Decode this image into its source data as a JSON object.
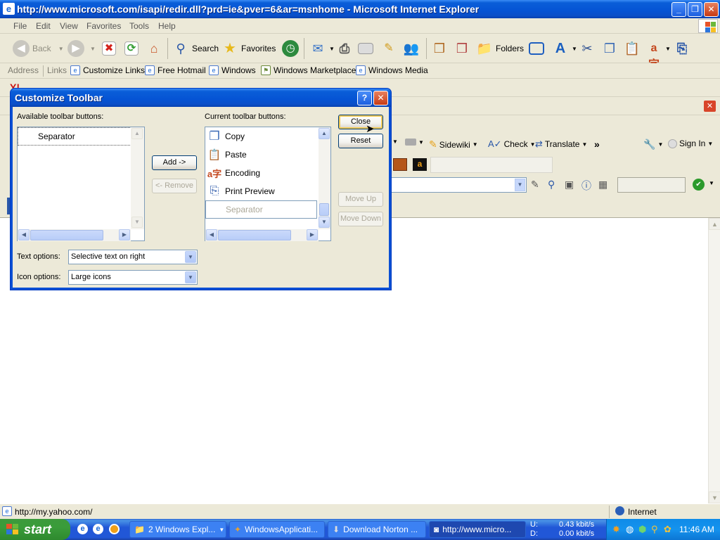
{
  "window": {
    "title": "http://www.microsoft.com/isapi/redir.dll?prd=ie&pver=6&ar=msnhome - Microsoft Internet Explorer",
    "minimize": "_",
    "maximize": "❐",
    "close": "✕"
  },
  "menu": [
    "File",
    "Edit",
    "View",
    "Favorites",
    "Tools",
    "Help"
  ],
  "toolbar": {
    "back": "Back",
    "search": "Search",
    "favorites": "Favorites",
    "folders": "Folders"
  },
  "links_bar": {
    "address": "Address",
    "links": "Links",
    "items": [
      "Customize Links",
      "Free Hotmail",
      "Windows",
      "Windows Marketplace",
      "Windows Media"
    ]
  },
  "yahoo_bar": {
    "sidewiki": "Sidewiki",
    "check": "Check",
    "translate": "Translate",
    "more": "»",
    "sign_in": "Sign In"
  },
  "dialog": {
    "title": "Customize Toolbar",
    "help": "?",
    "close_x": "✕",
    "available_label": "Available toolbar buttons:",
    "available_items": [
      "Separator"
    ],
    "current_label": "Current toolbar buttons:",
    "current_items": [
      "Copy",
      "Paste",
      "Encoding",
      "Print Preview",
      "Separator"
    ],
    "add_button": "Add ->",
    "remove_button": "<- Remove",
    "close_button": "Close",
    "reset_button": "Reset",
    "move_up_button": "Move Up",
    "move_down_button": "Move Down",
    "text_options_label": "Text options:",
    "text_options_value": "Selective text on right",
    "icon_options_label": "Icon options:",
    "icon_options_value": "Large icons"
  },
  "status": {
    "url": "http://my.yahoo.com/",
    "zone": "Internet"
  },
  "taskbar": {
    "start": "start",
    "tasks": [
      "2 Windows Expl...",
      "WindowsApplicati...",
      "Download Norton ...",
      "http://www.micro..."
    ],
    "net_up_label": "U:",
    "net_down_label": "D:",
    "net_up": "0.43 kbit/s",
    "net_down": "0.00 kbit/s",
    "clock": "11:46 AM"
  },
  "colors": {
    "titlebar": "#0553d4",
    "face": "#ece9d8",
    "taskbar": "#2157d7",
    "start": "#3a9c3a"
  }
}
